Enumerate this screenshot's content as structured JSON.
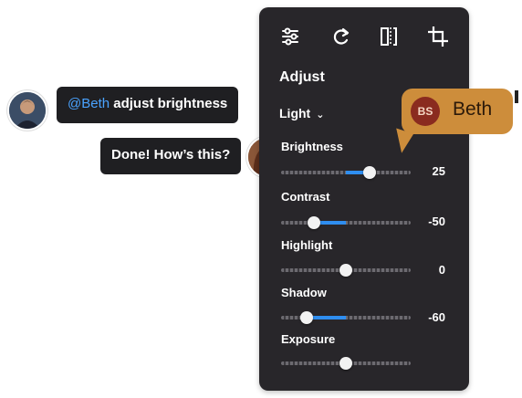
{
  "chat": {
    "message_one": {
      "mention": "@Beth",
      "text": " adjust brightness"
    },
    "message_two": {
      "text": "Done! How’s this?"
    }
  },
  "panel": {
    "tools": [
      "sliders-icon",
      "rotate-icon",
      "flip-icon",
      "crop-icon"
    ],
    "heading": "Adjust",
    "preset": "Light",
    "sliders": [
      {
        "label": "Brightness",
        "value": "25",
        "level": 0.68
      },
      {
        "label": "Contrast",
        "value": "-50",
        "level": 0.25
      },
      {
        "label": "Highlight",
        "value": "0",
        "level": 0.5
      },
      {
        "label": "Shadow",
        "value": "-60",
        "level": 0.2
      },
      {
        "label": "Exposure",
        "value": "",
        "level": 0.5
      }
    ]
  },
  "collaborator": {
    "initials": "BS",
    "name": "Beth"
  },
  "colors": {
    "accent": "#2f8ef0",
    "panel": "#28262a",
    "tag": "#cd8d3b"
  }
}
